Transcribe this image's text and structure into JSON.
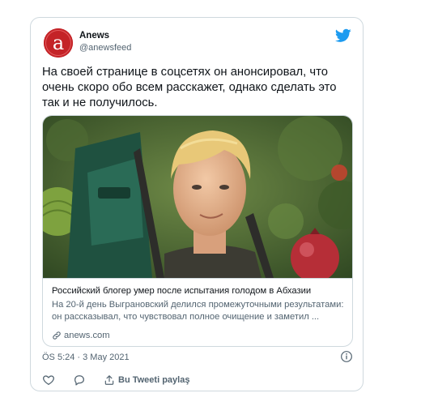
{
  "tweet": {
    "author": {
      "name": "Anews",
      "handle": "@anewsfeed",
      "avatar_letter": "a"
    },
    "text": "На своей странице в соцсетях он анонсировал, что очень скоро обо всем расскажет, однако сделать это так и не получилось.",
    "link_card": {
      "title": "Российский блогер умер после испытания голодом в Абхазии",
      "description": "На 20-й день Выграновский делился промежуточными результатами: он рассказывал, что чувствовал полное очищение и заметил ...",
      "domain": "anews.com"
    },
    "timestamp": "ÖS 5:24 · 3 May 2021",
    "actions": {
      "share_label": "Bu Tweeti paylaş"
    }
  },
  "icons": {
    "brand": "twitter-bird-icon",
    "info": "info-icon",
    "like": "heart-icon",
    "reply": "speech-bubble-icon",
    "link": "chain-link-icon"
  },
  "colors": {
    "twitter_blue": "#1d9bf0",
    "avatar_red": "#c42327",
    "secondary_text": "#536471",
    "border": "#cfd9de"
  }
}
